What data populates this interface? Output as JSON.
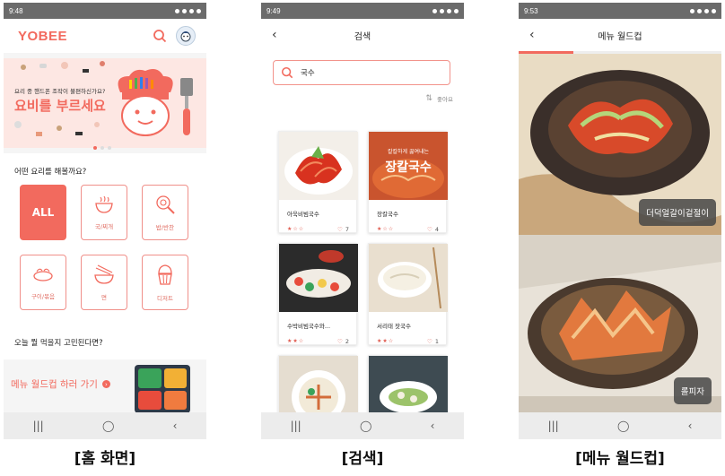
{
  "screens": {
    "home": {
      "status_time": "9:48",
      "logo": "YOBEE",
      "banner_subtitle": "요리 중 핸드폰 조작이 불편하신가요?",
      "banner_title": "요비를 부르세요",
      "question": "어떤 요리를 해볼까요?",
      "categories": [
        {
          "label": "ALL",
          "icon": "all"
        },
        {
          "label": "국/찌개",
          "icon": "soup-pot-icon"
        },
        {
          "label": "밥/반찬",
          "icon": "pan-icon"
        },
        {
          "label": "구이/볶음",
          "icon": "grill-icon"
        },
        {
          "label": "면",
          "icon": "noodle-bowl-icon"
        },
        {
          "label": "디저트",
          "icon": "cupcake-icon"
        }
      ],
      "question2": "오늘 뭘 먹을지 고민된다면?",
      "worldcup_link": "메뉴 월드컵 하러 가기",
      "caption": "[홈 화면]"
    },
    "search": {
      "status_time": "9:49",
      "title": "검색",
      "query": "국수",
      "sort_label": "좋아요",
      "results": [
        {
          "name": "아욱비빔국수",
          "stars": 1,
          "likes": "7"
        },
        {
          "name": "장칼국수",
          "stars": 1,
          "likes": "4"
        },
        {
          "name": "수박비빔국수와...",
          "stars": 2,
          "likes": "2"
        },
        {
          "name": "서리태 잣국수",
          "stars": 2,
          "likes": "1"
        },
        {
          "name": "",
          "stars": 0,
          "likes": ""
        },
        {
          "name": "",
          "stars": 0,
          "likes": ""
        }
      ],
      "thumb_text": "장칼국수",
      "thumb_subtext": "칼칼하게 끓여내는",
      "caption": "[검색]"
    },
    "worldcup": {
      "status_time": "9:53",
      "title": "메뉴 월드컵",
      "progress": 0.27,
      "option_a": "더덕얼갈이겉절이",
      "option_b": "롤피자",
      "caption": "[메뉴 월드컵]"
    }
  },
  "colors": {
    "accent": "#f26a5e",
    "status_bar": "#6b6b6b",
    "nav_bar": "#ececec"
  }
}
